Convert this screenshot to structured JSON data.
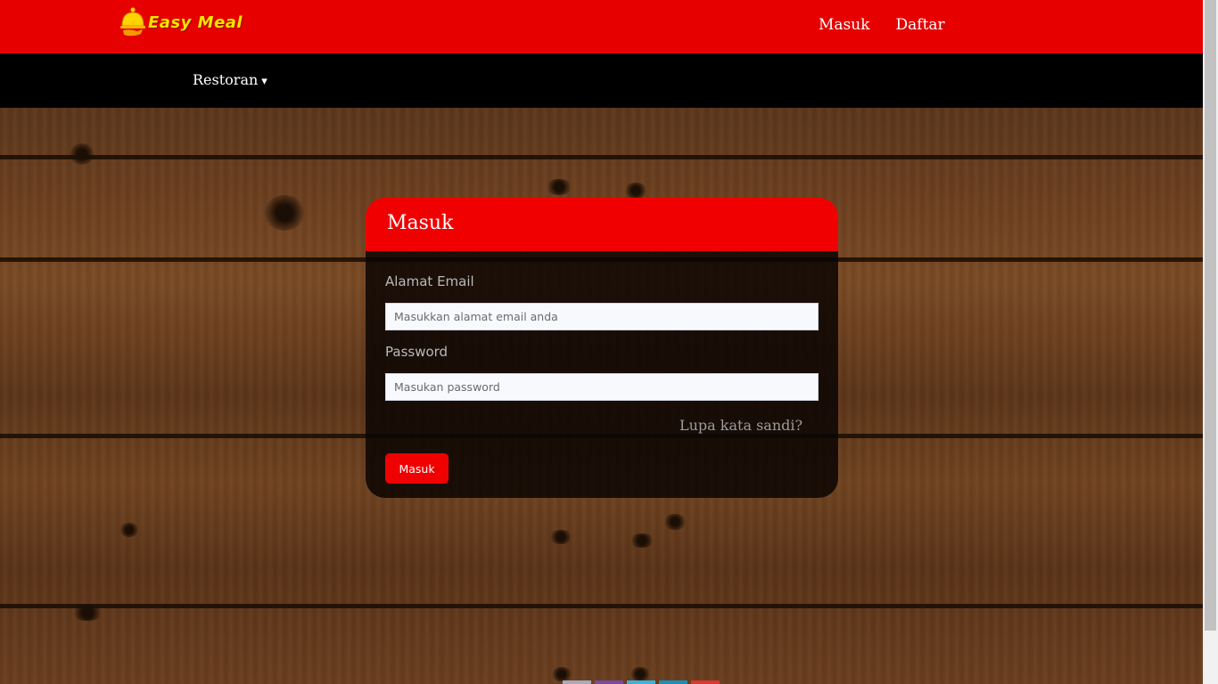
{
  "brand": {
    "name": "Easy Meal",
    "icon": "food-cloche-icon",
    "text_color": "#ffe400"
  },
  "header": {
    "bg_color": "#e60000",
    "links": [
      "Masuk",
      "Daftar"
    ]
  },
  "subnav": {
    "dropdown_label": "Restoran",
    "caret": "▾"
  },
  "login": {
    "title": "Masuk",
    "email_label": "Alamat Email",
    "email_placeholder": "Masukkan alamat email anda",
    "password_label": "Password",
    "password_placeholder": "Masukan password",
    "forgot_label": "Lupa kata sandi?",
    "submit_label": "Masuk",
    "accent_color": "#f00000"
  },
  "footer_tiles": [
    "#a9a9b9",
    "#7a4aa0",
    "#3fb1d8",
    "#1d8fb5",
    "#d9382e"
  ]
}
